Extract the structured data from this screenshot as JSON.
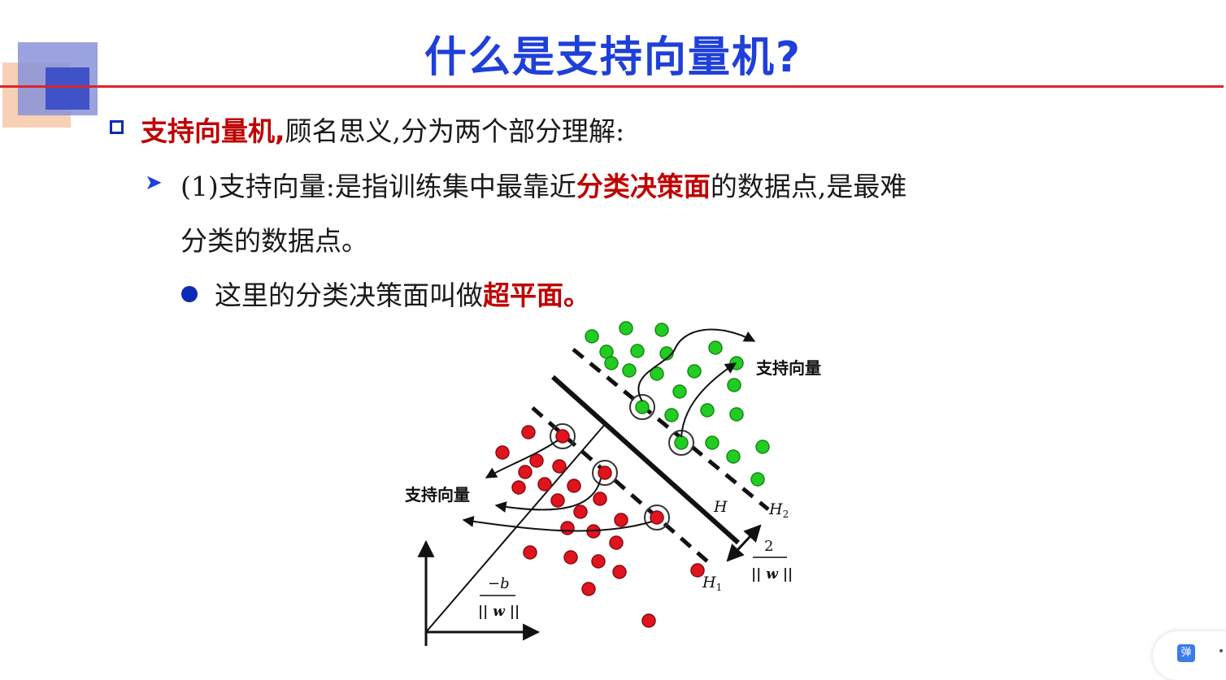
{
  "slide": {
    "title": "什么是支持向量机?",
    "line1": {
      "highlight": "支持向量机,",
      "text": "顾名思义,分为两个部分理解:"
    },
    "line2": {
      "prefix": "(1)支持向量:是指训练集中最靠近",
      "highlight": "分类决策面",
      "suffix": "的数据点,是最难"
    },
    "line3": {
      "text": "分类的数据点。"
    },
    "line4": {
      "prefix": "这里的分类决策面叫做",
      "highlight": "超平面。"
    }
  },
  "diagram": {
    "label_support_vector_right": "支持向量",
    "label_support_vector_left": "支持向量",
    "label_H": "H",
    "label_H1": "H",
    "label_H1_sub": "1",
    "label_H2": "H",
    "label_H2_sub": "2",
    "margin_numerator": "2",
    "margin_denominator": "|| w ||",
    "offset_numerator": "−b",
    "offset_denominator": "|| w ||",
    "colors": {
      "green": "#22cc22",
      "red": "#e0141e",
      "line": "#111111"
    }
  },
  "corner_widget": {
    "icon_label": "弹"
  },
  "colors": {
    "title": "#1f3fd9",
    "accent_red": "#c00000",
    "rule": "#d8262b"
  }
}
